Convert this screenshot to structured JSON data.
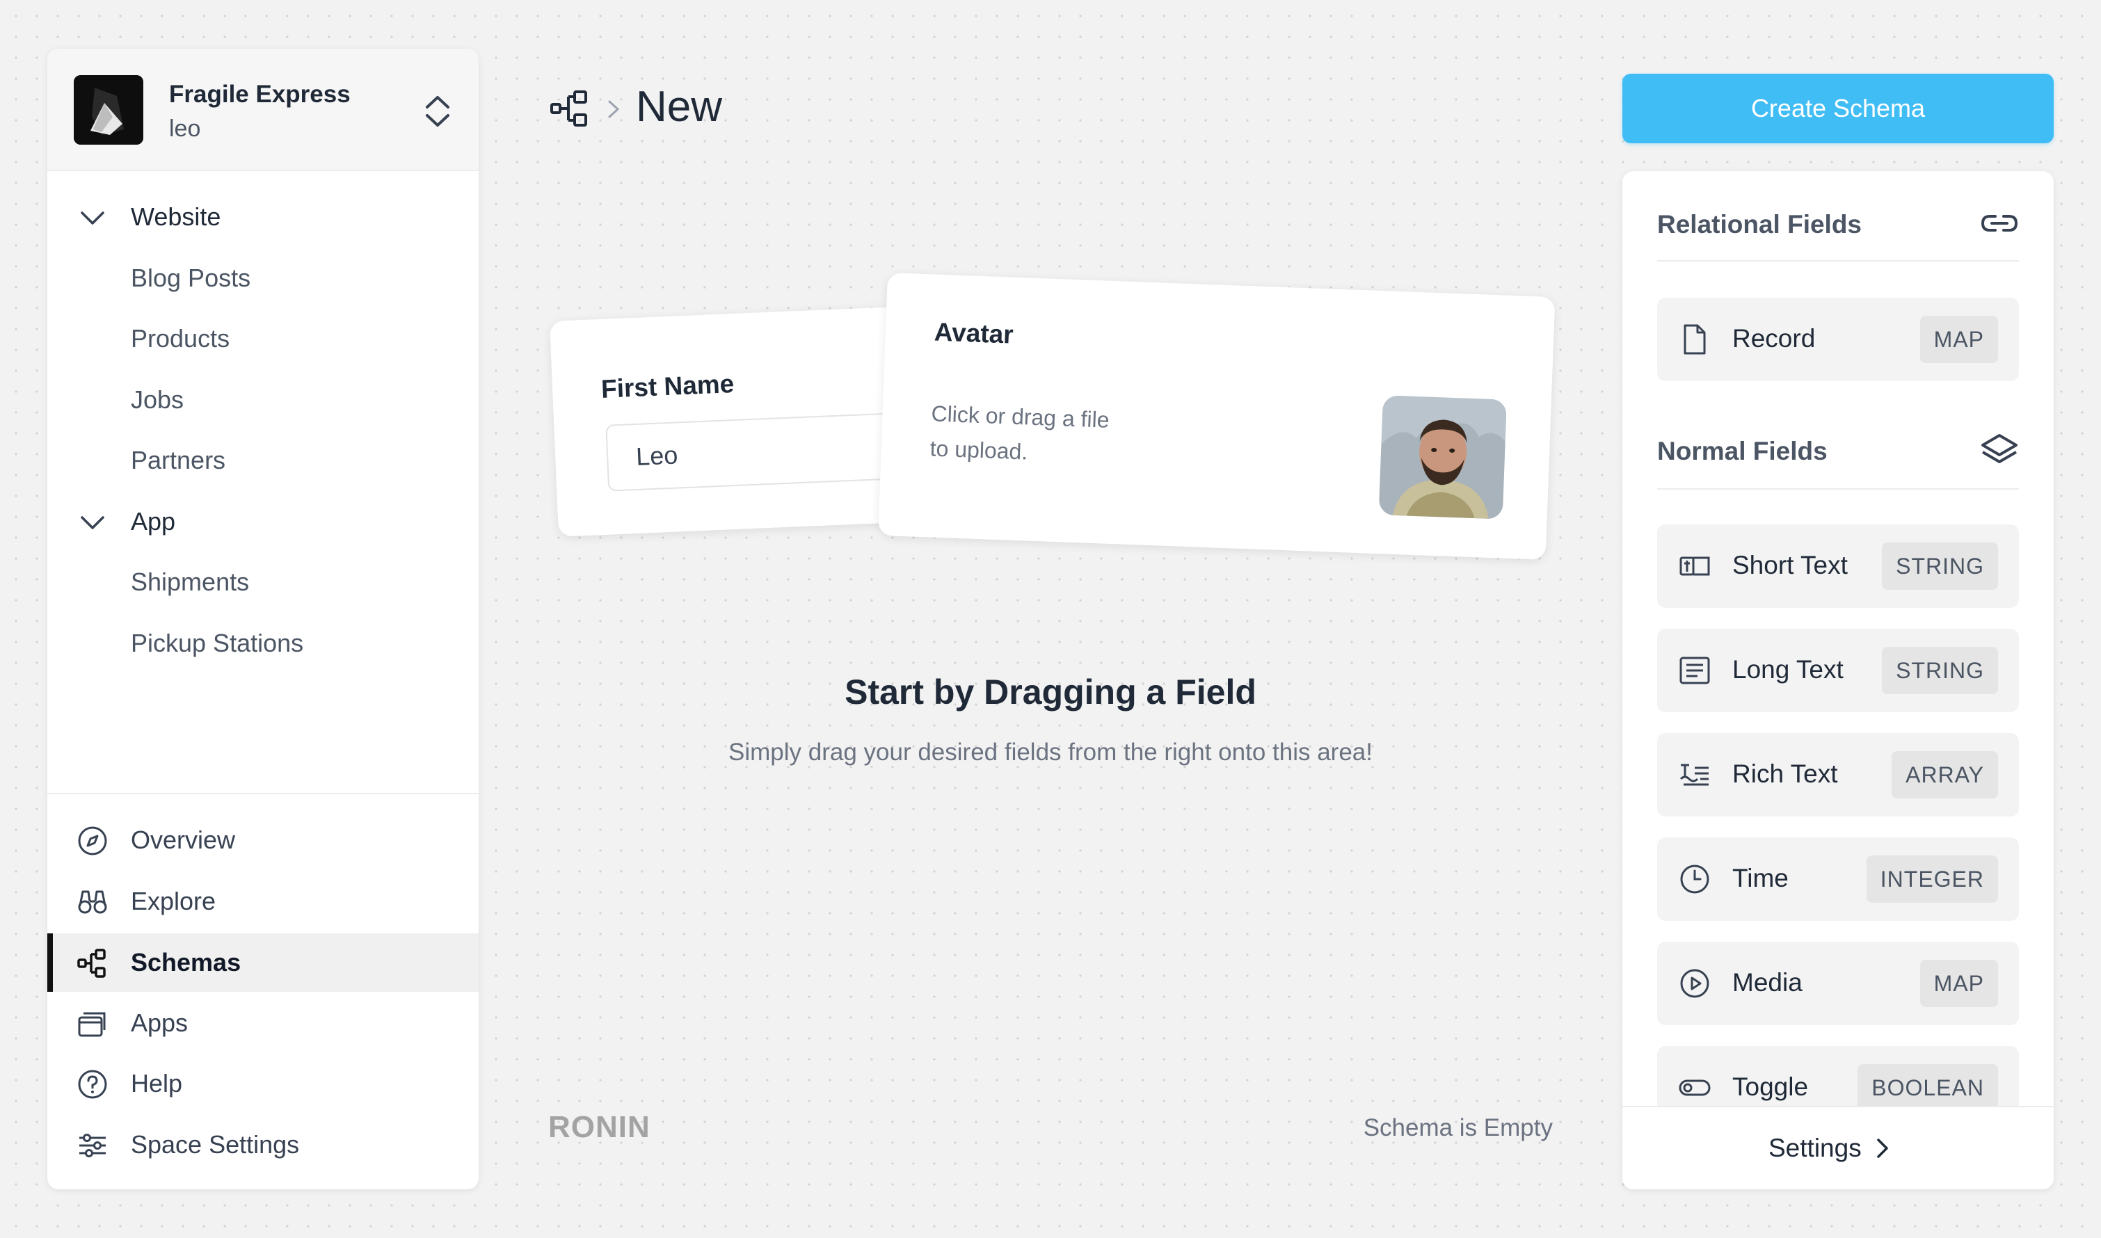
{
  "space": {
    "name": "Fragile Express",
    "user": "leo"
  },
  "sidebar": {
    "groups": [
      {
        "label": "Website",
        "items": [
          "Blog Posts",
          "Products",
          "Jobs",
          "Partners"
        ]
      },
      {
        "label": "App",
        "items": [
          "Shipments",
          "Pickup Stations"
        ]
      }
    ],
    "bottom": [
      {
        "label": "Overview",
        "icon": "compass-icon"
      },
      {
        "label": "Explore",
        "icon": "binoculars-icon"
      },
      {
        "label": "Schemas",
        "icon": "schema-icon",
        "active": true
      },
      {
        "label": "Apps",
        "icon": "windows-icon"
      },
      {
        "label": "Help",
        "icon": "help-icon"
      },
      {
        "label": "Space Settings",
        "icon": "sliders-icon"
      }
    ]
  },
  "header": {
    "title": "New"
  },
  "preview": {
    "first_name_label": "First Name",
    "first_name_value": "Leo",
    "avatar_label": "Avatar",
    "avatar_hint_line1": "Click or drag a file",
    "avatar_hint_line2": "to upload."
  },
  "empty_state": {
    "title": "Start by Dragging a Field",
    "subtitle": "Simply drag your desired fields from the right onto this area!"
  },
  "footer": {
    "brand": "RONIN",
    "status": "Schema is Empty"
  },
  "actions": {
    "create_label": "Create Schema"
  },
  "fields_panel": {
    "relational_title": "Relational Fields",
    "relational": [
      {
        "name": "Record",
        "type": "MAP",
        "icon": "document-icon"
      }
    ],
    "normal_title": "Normal Fields",
    "normal": [
      {
        "name": "Short Text",
        "type": "STRING",
        "icon": "short-text-icon"
      },
      {
        "name": "Long Text",
        "type": "STRING",
        "icon": "long-text-icon"
      },
      {
        "name": "Rich Text",
        "type": "ARRAY",
        "icon": "rich-text-icon"
      },
      {
        "name": "Time",
        "type": "INTEGER",
        "icon": "clock-icon"
      },
      {
        "name": "Media",
        "type": "MAP",
        "icon": "play-icon"
      },
      {
        "name": "Toggle",
        "type": "BOOLEAN",
        "icon": "toggle-icon"
      }
    ],
    "settings_label": "Settings"
  },
  "colors": {
    "accent": "#40bdf5",
    "background": "#f2f2f2",
    "panel": "#ffffff"
  }
}
